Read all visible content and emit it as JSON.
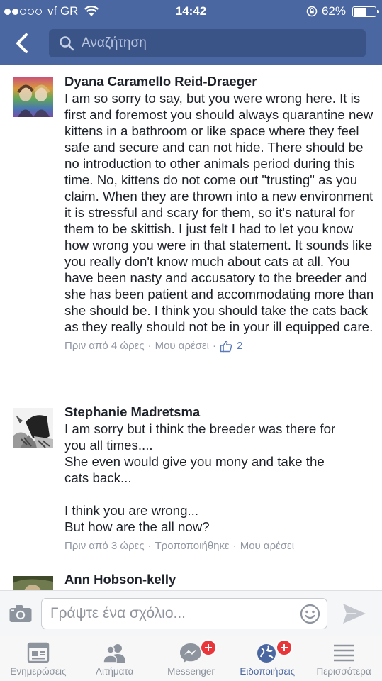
{
  "status_bar": {
    "carrier": "vf GR",
    "time": "14:42",
    "battery": "62%",
    "battery_level": 0.62
  },
  "header": {
    "search_placeholder": "Αναζήτηση"
  },
  "comments": [
    {
      "author": "Dyana Caramello Reid-Draeger",
      "text": "I am so sorry to say, but you were wrong here. It is first and foremost you should always quarantine new kittens in a bathroom or like space where they feel safe and secure and can not hide. There should be no introduction to other animals period during this time. No, kittens do not come out \"trusting\" as you claim. When they are thrown into a new environment it is stressful and scary for them, so it's natural for them to be skittish. I just felt I had to let you know how wrong you were in that statement. It sounds like you really don't know much about cats at all. You have been nasty and accusatory to the breeder and she has been patient and accommodating more than she should be. I think you should take the cats back as they really should not be in your ill equipped care.",
      "time": "Πριν από 4 ώρες",
      "like_label": "Μου αρέσει",
      "likes": "2"
    },
    {
      "author": "Stephanie Madretsma",
      "lines": [
        "I am sorry but i think the breeder was there for",
        "you all times....",
        "She even would give you mony and take the",
        "cats back...",
        "",
        "I think you are wrong...",
        "But how are the all now?"
      ],
      "time": "Πριν από 3 ώρες",
      "edited": "Τροποποιήθηκε",
      "like_label": "Μου αρέσει"
    },
    {
      "author": "Ann Hobson-kelly"
    }
  ],
  "composer": {
    "placeholder": "Γράψτε ένα σχόλιο..."
  },
  "tabs": [
    {
      "label": "Ενημερώσεις",
      "icon": "news-feed-icon"
    },
    {
      "label": "Αιτήματα",
      "icon": "friend-requests-icon"
    },
    {
      "label": "Messenger",
      "icon": "messenger-icon"
    },
    {
      "label": "Ειδοποιήσεις",
      "icon": "notifications-globe-icon"
    },
    {
      "label": "Περισσότερα",
      "icon": "more-menu-icon"
    }
  ],
  "colors": {
    "brand": "#4b67a1",
    "search_bg": "#3b5487",
    "badge": "#e8363b",
    "meta_text": "#9197a3"
  }
}
